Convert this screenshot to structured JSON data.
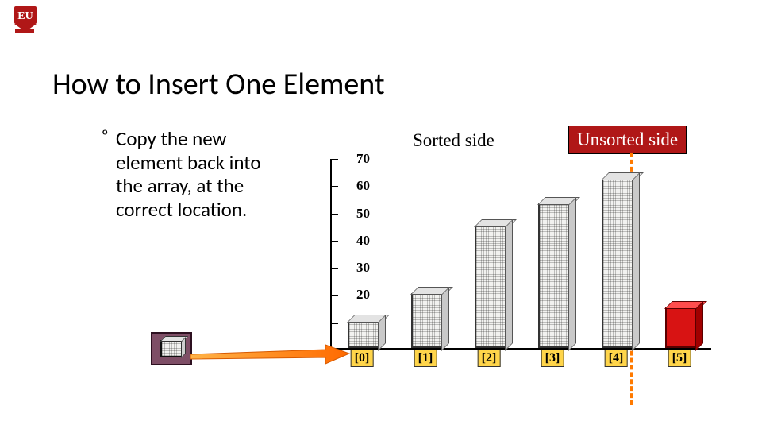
{
  "logo_alt": "EU",
  "title": "How to Insert One Element",
  "bullet": {
    "icon": "º",
    "text": "Copy the new element back into the array, at the correct location."
  },
  "labels": {
    "sorted": "Sorted side",
    "unsorted": "Unsorted side"
  },
  "newbox_value_approx": 10,
  "chart_data": {
    "type": "bar",
    "title": "",
    "xlabel": "",
    "ylabel": "",
    "ylim": [
      0,
      70
    ],
    "yticks": [
      0,
      10,
      20,
      30,
      40,
      50,
      60,
      70
    ],
    "categories": [
      "[0]",
      "[1]",
      "[2]",
      "[3]",
      "[4]",
      "[5]"
    ],
    "values": [
      10,
      20,
      45,
      53,
      62,
      15
    ],
    "highlight_index": 5,
    "divider_after_index": 4
  }
}
